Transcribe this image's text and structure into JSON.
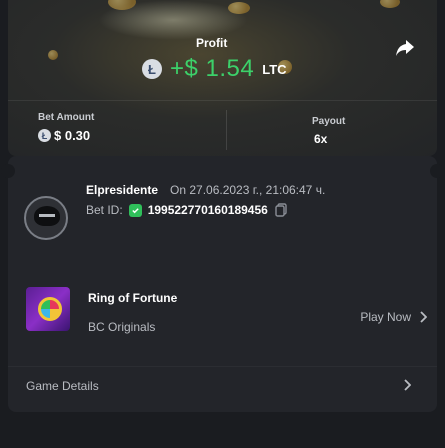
{
  "summary": {
    "profit_label": "Profit",
    "profit_value": "+$ 1.54",
    "profit_currency": "LTC",
    "bet_amount_label": "Bet Amount",
    "bet_amount_value": "$ 0.30",
    "payout_label": "Payout",
    "payout_value": "6x"
  },
  "bet": {
    "username": "Elpresidente",
    "timestamp": "On 27.06.2023 г., 21:06:47 ч.",
    "bet_id_label": "Bet ID:",
    "bet_id_value": "199522770160189456"
  },
  "game": {
    "name": "Ring of Fortune",
    "provider": "BC Originals",
    "play_label": "Play Now"
  },
  "details": {
    "label": "Game Details"
  },
  "icons": {
    "currency": "litecoin-icon",
    "share": "share-icon",
    "verified": "verified-shield-icon",
    "copy": "copy-icon",
    "chevron": "chevron-right-icon"
  },
  "colors": {
    "profit": "#3cd16a",
    "verified": "#2fbf5a",
    "background": "#1a1c20",
    "card": "#23252a"
  }
}
